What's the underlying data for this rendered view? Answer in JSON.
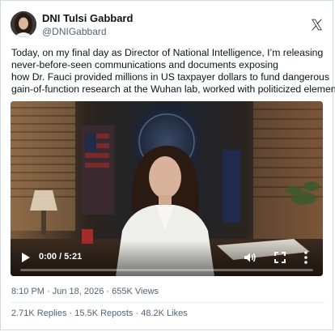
{
  "author": {
    "display_name": "DNI Tulsi Gabbard",
    "handle": "@DNIGabbard"
  },
  "platform_icon": "x-logo-icon",
  "tweet": {
    "lines": [
      "Today, on my final day as Director of National Intelligence, I’m releasing",
      "never-before-seen communications and documents exposing",
      "how Dr. Fauci provided millions in US taxpayer dollars to fund dangerous",
      "gain-of-function research at the Wuhan lab, worked with politicized elements"
    ]
  },
  "video": {
    "time_display": "0:00 / 5:21",
    "progress": 0.0,
    "icons": [
      "play-icon",
      "volume-icon",
      "fullscreen-icon",
      "more-options-icon"
    ]
  },
  "meta": {
    "time": "8:10 PM",
    "date": "Jun 18, 2026",
    "views": "655K Views",
    "separator": " · "
  },
  "stats": {
    "replies": "2.71K Replies",
    "reposts": "15.5K Reposts",
    "likes": "48.2K Likes",
    "separator": " · "
  }
}
